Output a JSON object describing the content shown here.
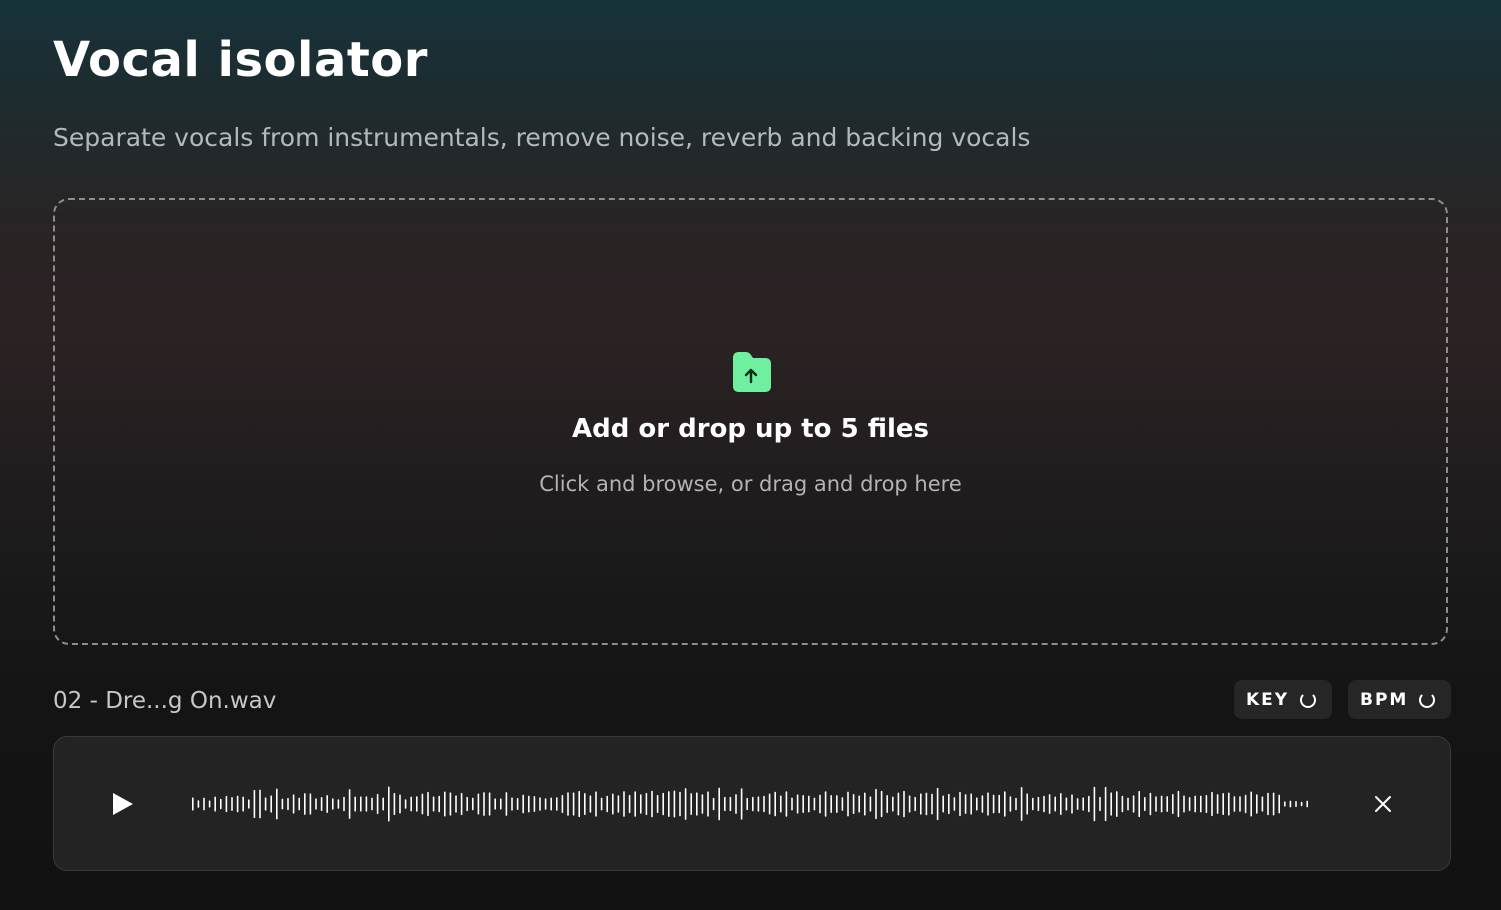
{
  "header": {
    "title": "Vocal isolator",
    "subtitle": "Separate vocals from instrumentals, remove noise, reverb and backing vocals"
  },
  "dropzone": {
    "icon": "folder-upload-icon",
    "title": "Add or drop up to 5 files",
    "hint": "Click and browse, or drag and drop here"
  },
  "file": {
    "name": "02 - Dre...g On.wav",
    "key_label": "KEY",
    "bpm_label": "BPM"
  },
  "player": {
    "play_icon": "play-icon",
    "close_icon": "close-icon"
  },
  "colors": {
    "accent": "#6ef0a0",
    "text_muted": "#b6b9bb"
  }
}
